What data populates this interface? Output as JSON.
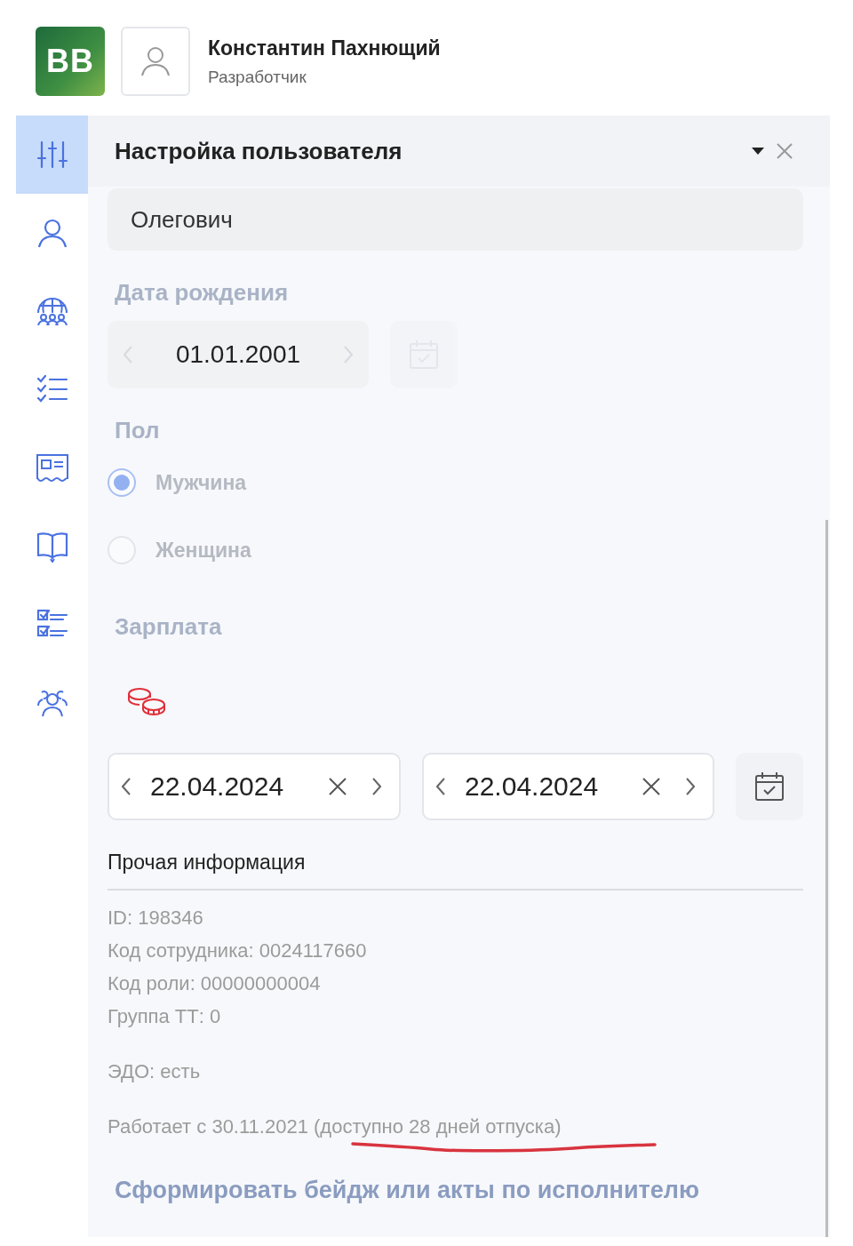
{
  "header": {
    "logo": "BB",
    "user_name": "Константин Пахнющий",
    "user_role": "Разработчик"
  },
  "sidebar": {
    "items": [
      {
        "kind": "sliders",
        "selected": true
      },
      {
        "kind": "user",
        "selected": false
      },
      {
        "kind": "globe",
        "selected": false
      },
      {
        "kind": "checklist",
        "selected": false
      },
      {
        "kind": "card",
        "selected": false
      },
      {
        "kind": "book",
        "selected": false
      },
      {
        "kind": "tasks",
        "selected": false
      },
      {
        "kind": "team",
        "selected": false
      }
    ]
  },
  "panel": {
    "title": "Настройка пользователя",
    "patronymic": {
      "value": "Олегович"
    },
    "birth_date": {
      "label": "Дата рождения",
      "value": "01.01.2001",
      "disabled": true
    },
    "gender": {
      "label": "Пол",
      "disabled": true,
      "options": [
        {
          "label": "Мужчина",
          "selected": true
        },
        {
          "label": "Женщина",
          "selected": false
        }
      ]
    },
    "salary": {
      "label": "Зарплата"
    },
    "date_range": {
      "from": "22.04.2024",
      "to": "22.04.2024"
    },
    "other_info": {
      "title": "Прочая информация",
      "lines": [
        "ID: 198346",
        "Код сотрудника: 0024117660",
        "Код роли: 00000000004",
        "Группа ТТ: 0"
      ],
      "edo": "ЭДО: есть",
      "working_since": "Работает с 30.11.2021 (доступно 28 дней отпуска)"
    },
    "badge_link": "Сформировать бейдж или акты по исполнителю"
  }
}
